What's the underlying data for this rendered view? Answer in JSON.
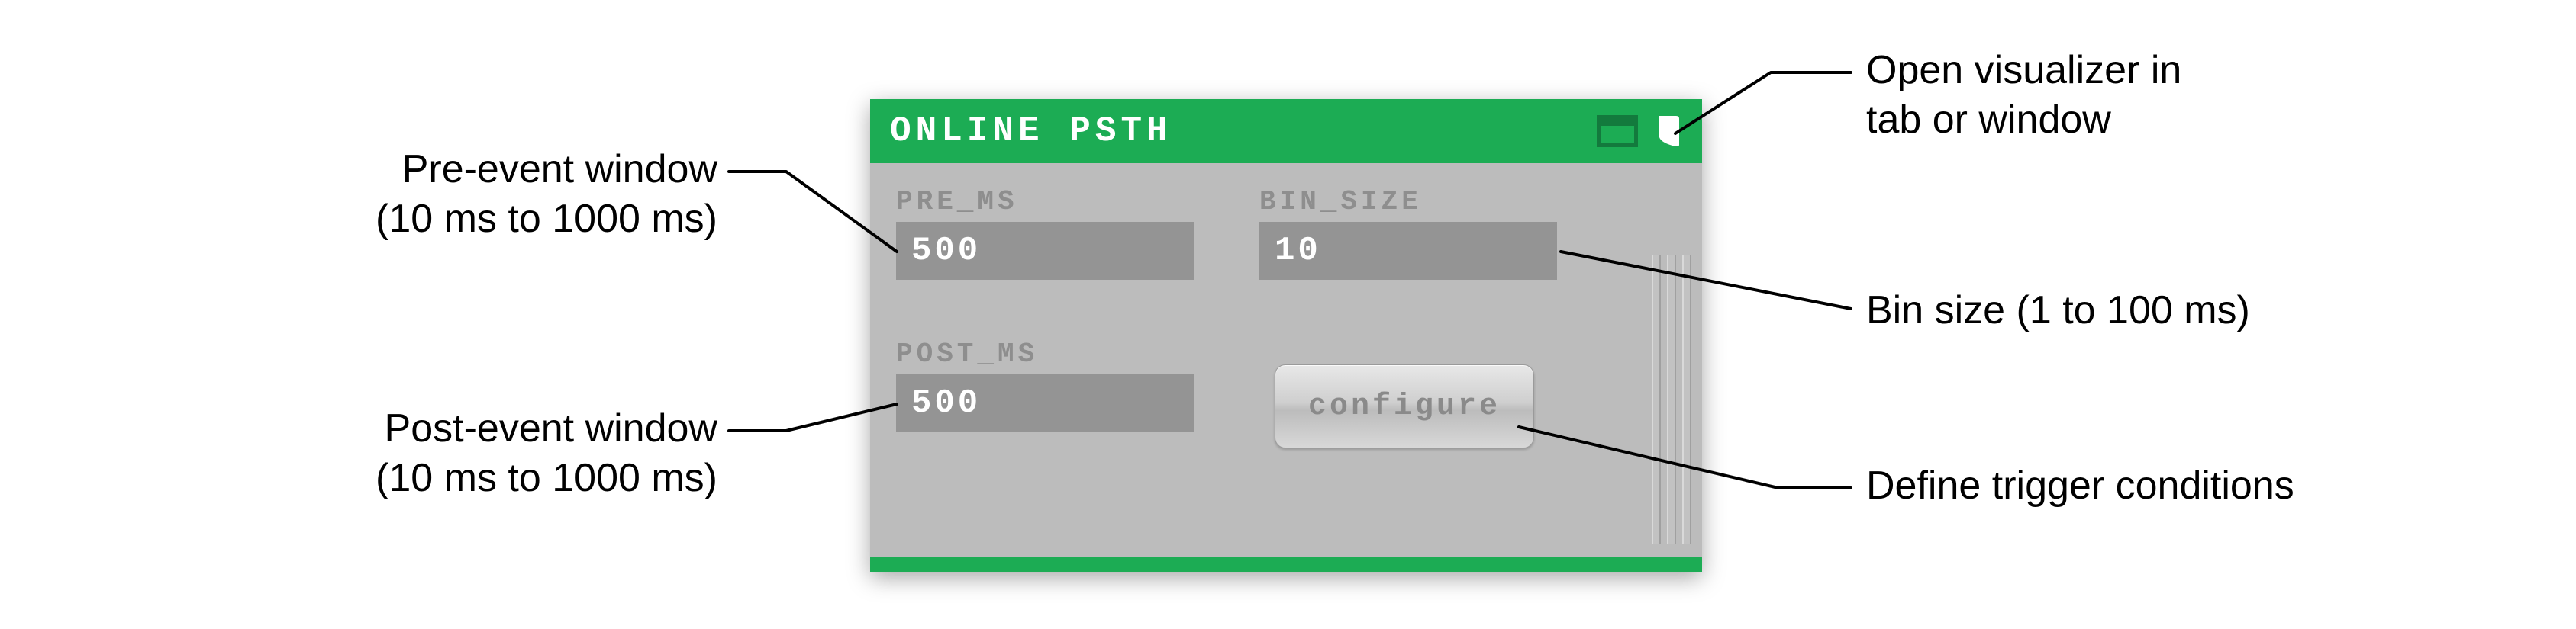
{
  "plugin": {
    "title": "ONLINE PSTH",
    "icons": {
      "tab": "tab-icon",
      "window": "window-icon"
    },
    "fields": {
      "pre_ms": {
        "label": "PRE_MS",
        "value": "500"
      },
      "bin_size": {
        "label": "BIN_SIZE",
        "value": "10"
      },
      "post_ms": {
        "label": "POST_MS",
        "value": "500"
      }
    },
    "buttons": {
      "configure": "configure"
    }
  },
  "annotations": {
    "pre_ms": {
      "line1": "Pre-event window",
      "line2": "(10 ms to 1000 ms)"
    },
    "post_ms": {
      "line1": "Post-event window",
      "line2": "(10 ms to 1000 ms)"
    },
    "bin_size": "Bin size (1 to 100 ms)",
    "visualizer": {
      "line1": "Open visualizer in",
      "line2": "tab or window"
    },
    "configure": "Define trigger conditions"
  }
}
